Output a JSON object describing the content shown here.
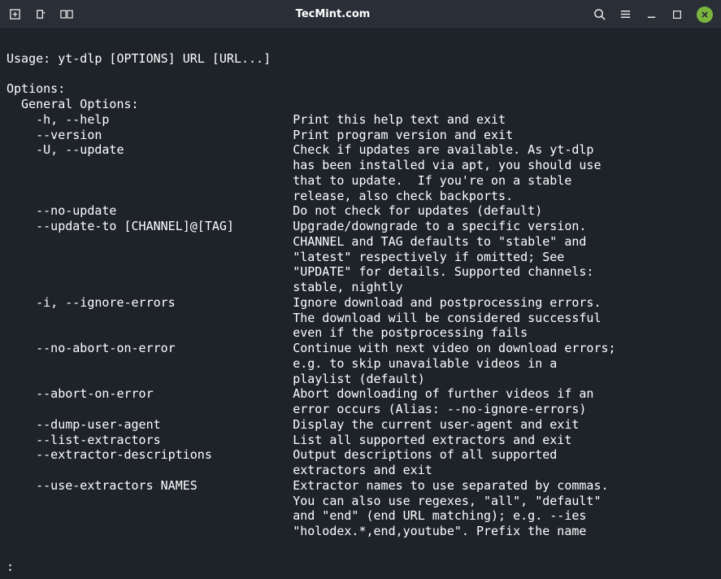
{
  "window": {
    "title": "TecMint.com"
  },
  "usage": "Usage: yt-dlp [OPTIONS] URL [URL...]",
  "options_header": "Options:",
  "section_header": "  General Options:",
  "options": [
    {
      "flag": "    -h, --help",
      "desc": [
        "Print this help text and exit"
      ]
    },
    {
      "flag": "    --version",
      "desc": [
        "Print program version and exit"
      ]
    },
    {
      "flag": "    -U, --update",
      "desc": [
        "Check if updates are available. As yt-dlp",
        "has been installed via apt, you should use",
        "that to update.  If you're on a stable",
        "release, also check backports."
      ]
    },
    {
      "flag": "    --no-update",
      "desc": [
        "Do not check for updates (default)"
      ]
    },
    {
      "flag": "    --update-to [CHANNEL]@[TAG]",
      "desc": [
        "Upgrade/downgrade to a specific version.",
        "CHANNEL and TAG defaults to \"stable\" and",
        "\"latest\" respectively if omitted; See",
        "\"UPDATE\" for details. Supported channels:",
        "stable, nightly"
      ]
    },
    {
      "flag": "    -i, --ignore-errors",
      "desc": [
        "Ignore download and postprocessing errors.",
        "The download will be considered successful",
        "even if the postprocessing fails"
      ]
    },
    {
      "flag": "    --no-abort-on-error",
      "desc": [
        "Continue with next video on download errors;",
        "e.g. to skip unavailable videos in a",
        "playlist (default)"
      ]
    },
    {
      "flag": "    --abort-on-error",
      "desc": [
        "Abort downloading of further videos if an",
        "error occurs (Alias: --no-ignore-errors)"
      ]
    },
    {
      "flag": "    --dump-user-agent",
      "desc": [
        "Display the current user-agent and exit"
      ]
    },
    {
      "flag": "    --list-extractors",
      "desc": [
        "List all supported extractors and exit"
      ]
    },
    {
      "flag": "    --extractor-descriptions",
      "desc": [
        "Output descriptions of all supported",
        "extractors and exit"
      ]
    },
    {
      "flag": "    --use-extractors NAMES",
      "desc": [
        "Extractor names to use separated by commas.",
        "You can also use regexes, \"all\", \"default\"",
        "and \"end\" (end URL matching); e.g. --ies",
        "\"holodex.*,end,youtube\". Prefix the name"
      ]
    }
  ],
  "prompt": ":"
}
